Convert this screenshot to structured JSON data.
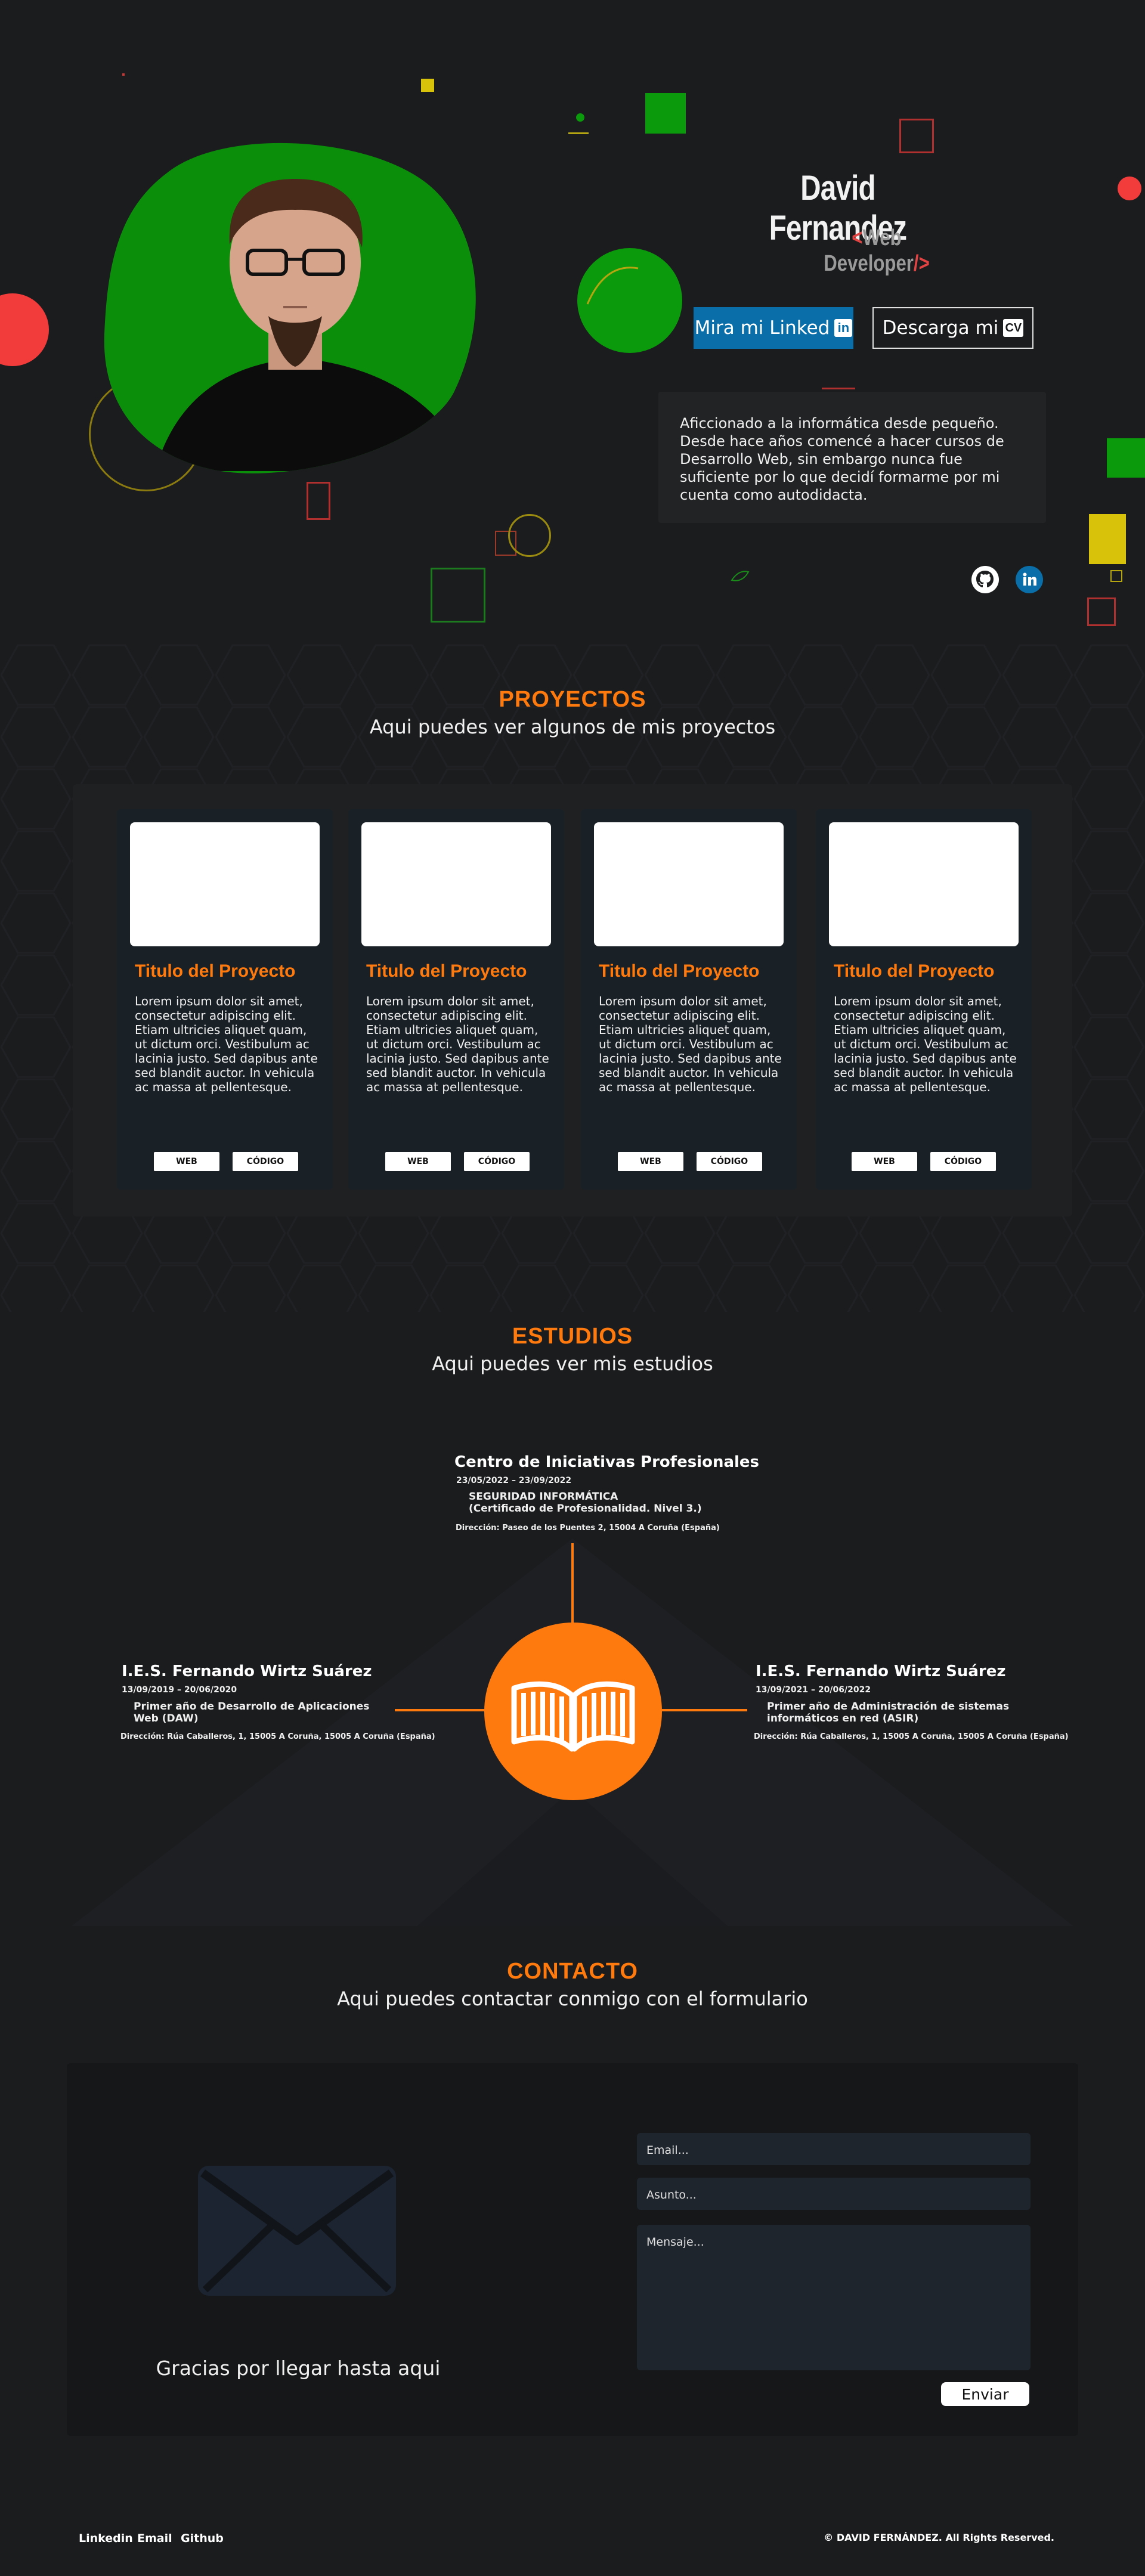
{
  "hero": {
    "name": "David Fernandez",
    "role_open": "<",
    "role_text": "Web Developer",
    "role_close": "/>",
    "linkedin_button": "Mira mi Linked",
    "linkedin_badge": "in",
    "cv_button": "Descarga mi",
    "cv_badge": "CV",
    "bio": "Aficcionado a la informática desde pequeño. Desde hace años comencé a hacer cursos de Desarrollo Web, sin embargo nunca fue suficiente por lo que decidí formarme por mi cuenta como autodidacta.",
    "social_icons": [
      "github-icon",
      "linkedin-icon"
    ],
    "colors": {
      "blob": "#0b8f0b",
      "accent_red": "#e24444",
      "linkedin_blue": "#0a6ea8"
    }
  },
  "projects": {
    "title": "PROYECTOS",
    "subtitle": "Aqui puedes ver algunos de mis proyectos",
    "cards": [
      {
        "title": "Titulo del Proyecto",
        "desc": "Lorem ipsum dolor sit amet, consectetur adipiscing elit. Etiam ultricies aliquet quam, ut dictum orci. Vestibulum ac lacinia justo. Sed dapibus ante sed blandit auctor. In vehicula ac massa at pellentesque.",
        "web": "WEB",
        "code": "CÓDIGO"
      },
      {
        "title": "Titulo del Proyecto",
        "desc": "Lorem ipsum dolor sit amet, consectetur adipiscing elit. Etiam ultricies aliquet quam, ut dictum orci. Vestibulum ac lacinia justo. Sed dapibus ante sed blandit auctor. In vehicula ac massa at pellentesque.",
        "web": "WEB",
        "code": "CÓDIGO"
      },
      {
        "title": "Titulo del Proyecto",
        "desc": "Lorem ipsum dolor sit amet, consectetur adipiscing elit. Etiam ultricies aliquet quam, ut dictum orci. Vestibulum ac lacinia justo. Sed dapibus ante sed blandit auctor. In vehicula ac massa at pellentesque.",
        "web": "WEB",
        "code": "CÓDIGO"
      },
      {
        "title": "Titulo del Proyecto",
        "desc": "Lorem ipsum dolor sit amet, consectetur adipiscing elit. Etiam ultricies aliquet quam, ut dictum orci. Vestibulum ac lacinia justo. Sed dapibus ante sed blandit auctor. In vehicula ac massa at pellentesque.",
        "web": "WEB",
        "code": "CÓDIGO"
      }
    ]
  },
  "studies": {
    "title": "ESTUDIOS",
    "subtitle": "Aqui puedes ver mis estudios",
    "top": {
      "school": "Centro de Iniciativas Profesionales",
      "date": "23/05/2022 – 23/09/2022",
      "course_line1": "SEGURIDAD INFORMÁTICA",
      "course_line2": "(Certificado de Profesionalidad. Nivel 3.)",
      "address": "Dirección: Paseo de los Puentes 2, 15004 A Coruña (España)"
    },
    "left": {
      "school": "I.E.S. Fernando Wirtz Suárez",
      "date": "13/09/2019 – 20/06/2020",
      "course_line1": "Primer año de Desarrollo de Aplicaciones",
      "course_line2": "Web (DAW)",
      "address": "Dirección: Rúa Caballeros, 1, 15005 A Coruña, 15005 A Coruña (España)"
    },
    "right": {
      "school": "I.E.S. Fernando Wirtz Suárez",
      "date": "13/09/2021 – 20/06/2022",
      "course_line1": "Primer año de Administración de sistemas",
      "course_line2": "informáticos en red (ASIR)",
      "address": "Dirección: Rúa Caballeros, 1, 15005 A Coruña, 15005 A Coruña (España)"
    },
    "center_icon": "open-book-icon",
    "colors": {
      "orange": "#ff7a0e"
    }
  },
  "contact": {
    "title": "CONTACTO",
    "subtitle": "Aqui puedes contactar conmigo con el formulario",
    "email_placeholder": "Email...",
    "subject_placeholder": "Asunto...",
    "message_placeholder": "Mensaje...",
    "send_label": "Enviar",
    "thanks": "Gracias por llegar hasta aqui",
    "icon": "envelope-icon"
  },
  "footer": {
    "links": [
      "Linkedin",
      "Email",
      "Github"
    ],
    "copyright": "© DAVID FERNÁNDEZ. All Rights Reserved."
  }
}
